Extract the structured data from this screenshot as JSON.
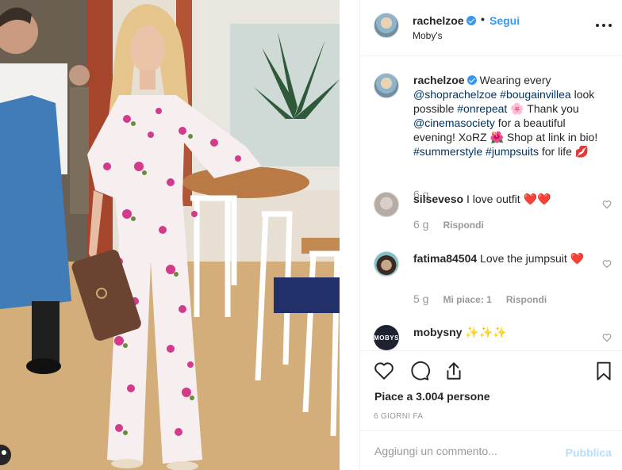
{
  "post": {
    "username": "rachelzoe",
    "follow_label": "Segui",
    "separator": "•",
    "location": "Moby's"
  },
  "caption": {
    "username": "rachelzoe",
    "text_1": " Wearing every ",
    "mention_1": "@shoprachelzoe",
    "text_2": " ",
    "hashtag_1": "#bougainvillea",
    "text_3": " look possible ",
    "hashtag_2": "#onrepeat",
    "text_4": " 🌸 Thank you ",
    "mention_2": "@cinemasociety",
    "text_5": " for a beautiful evening! XoRZ 🌺 Shop at link in bio! ",
    "hashtag_3": "#summerstyle",
    "text_6": " ",
    "hashtag_4": "#jumpsuits",
    "text_7": " for life 💋",
    "time": "6 g"
  },
  "comments": [
    {
      "username": "silseveso",
      "text": " I love outfit ❤️❤️",
      "time": "6 g",
      "reply": "Rispondi"
    },
    {
      "username": "fatima84504",
      "text": " Love the jumpsuit ❤️",
      "time": "5 g",
      "likes": "Mi piace: 1",
      "reply": "Rispondi"
    },
    {
      "username": "mobysny",
      "text": " ✨✨✨",
      "avatar_text": "MOBYS"
    }
  ],
  "actions": {
    "likes_text": "Piace a 3.004 persone",
    "timestamp": "6 GIORNI FA"
  },
  "add_comment": {
    "placeholder": "Aggiungi un commento...",
    "publish_label": "Pubblica"
  },
  "colors": {
    "accent": "#3897f0",
    "link": "#003569",
    "muted": "#999999",
    "publish_disabled": "#b2dffc"
  },
  "icons": [
    "verified-badge-icon",
    "more-options-icon",
    "heart-icon",
    "comment-icon",
    "share-icon",
    "bookmark-icon"
  ]
}
